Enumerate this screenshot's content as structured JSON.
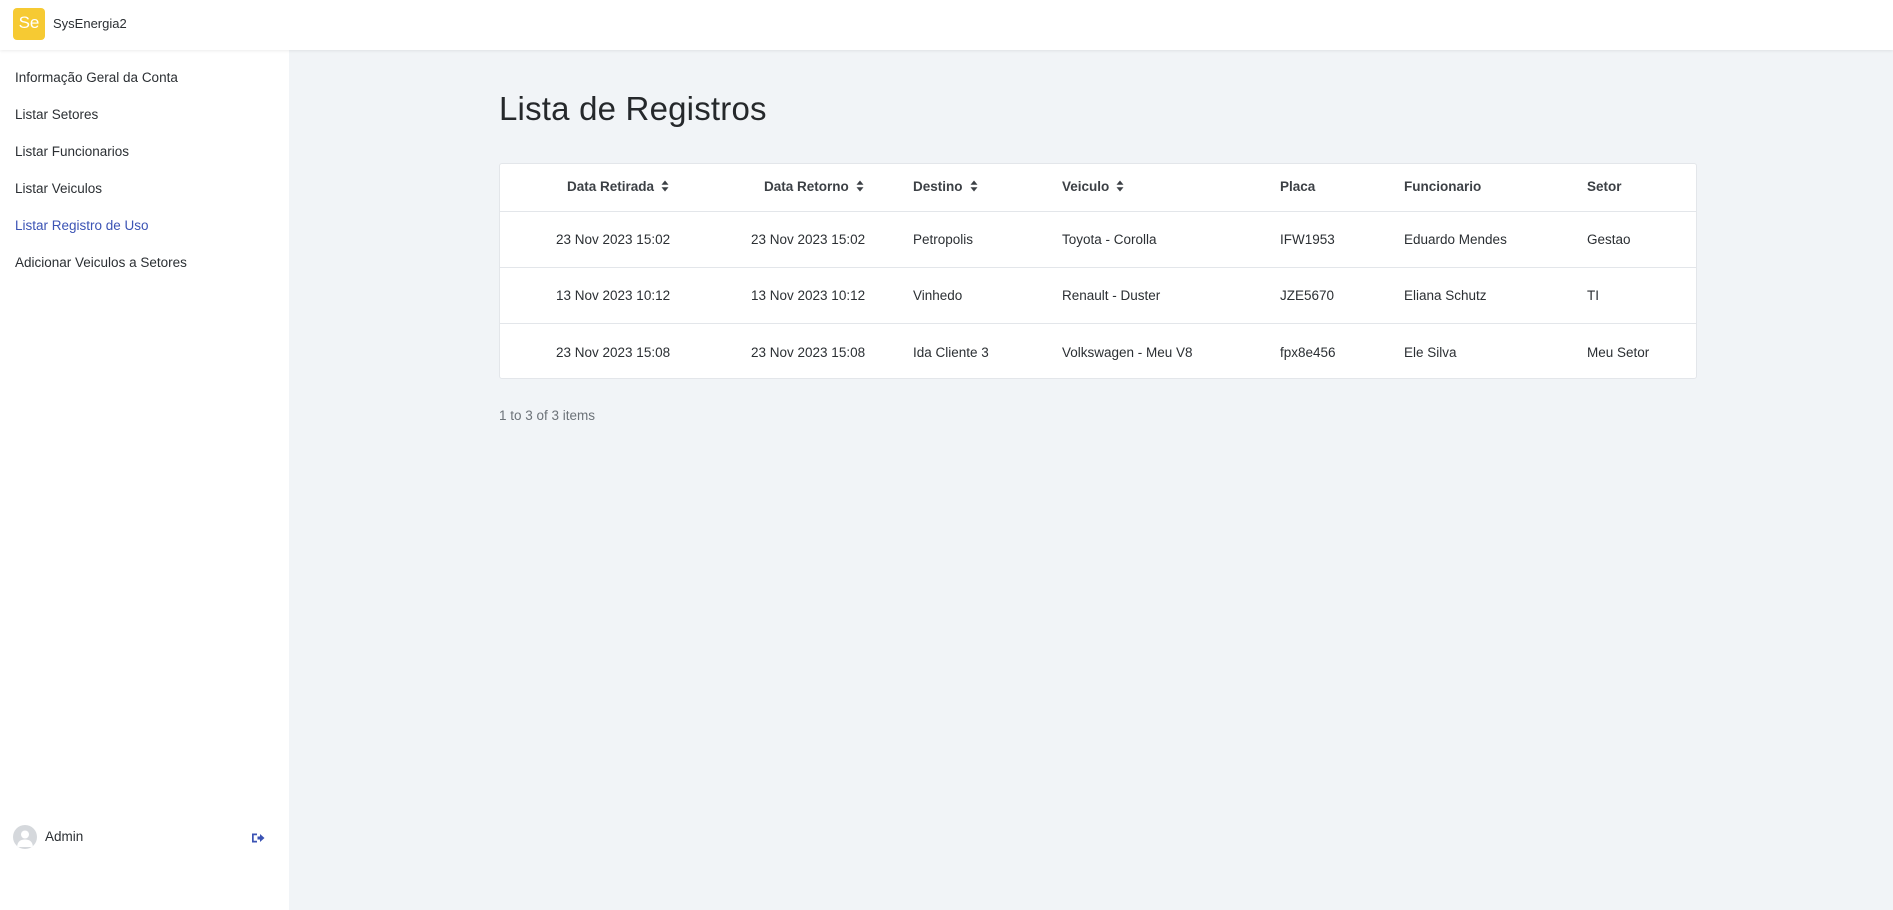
{
  "app": {
    "logo_text": "Se",
    "name": "SysEnergia2",
    "accent_color": "#f6ca33",
    "active_color": "#3b53b4"
  },
  "sidebar": {
    "items": [
      {
        "label": "Informação Geral da Conta",
        "active": false
      },
      {
        "label": "Listar Setores",
        "active": false
      },
      {
        "label": "Listar Funcionarios",
        "active": false
      },
      {
        "label": "Listar Veiculos",
        "active": false
      },
      {
        "label": "Listar Registro de Uso",
        "active": true
      },
      {
        "label": "Adicionar Veiculos a Setores",
        "active": false
      }
    ],
    "user": {
      "name": "Admin",
      "avatar_icon": "user-avatar-icon",
      "logout_icon": "logout-icon"
    }
  },
  "main": {
    "title": "Lista de Registros",
    "table": {
      "columns": [
        {
          "label": "Data Retirada",
          "sortable": true
        },
        {
          "label": "Data Retorno",
          "sortable": true
        },
        {
          "label": "Destino",
          "sortable": true
        },
        {
          "label": "Veiculo",
          "sortable": true
        },
        {
          "label": "Placa",
          "sortable": false
        },
        {
          "label": "Funcionario",
          "sortable": false
        },
        {
          "label": "Setor",
          "sortable": false
        }
      ],
      "rows": [
        [
          "23 Nov 2023 15:02",
          "23 Nov 2023 15:02",
          "Petropolis",
          "Toyota - Corolla",
          "IFW1953",
          "Eduardo Mendes",
          "Gestao"
        ],
        [
          "13 Nov 2023 10:12",
          "13 Nov 2023 10:12",
          "Vinhedo",
          "Renault - Duster",
          "JZE5670",
          "Eliana Schutz",
          "TI"
        ],
        [
          "23 Nov 2023 15:08",
          "23 Nov 2023 15:08",
          "Ida Cliente 3",
          "Volkswagen - Meu V8",
          "fpx8e456",
          "Ele Silva",
          "Meu Setor"
        ]
      ]
    },
    "pagination": {
      "summary": "1 to 3 of 3 items"
    }
  }
}
